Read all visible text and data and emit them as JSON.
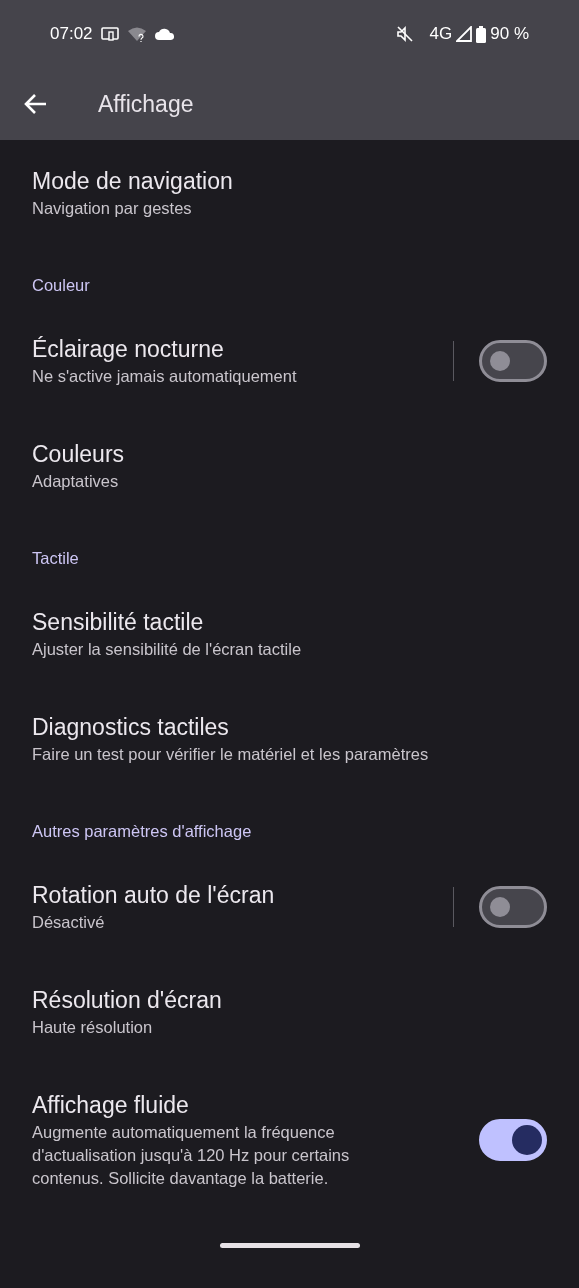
{
  "status_bar": {
    "time": "07:02",
    "network": "4G",
    "battery": "90 %"
  },
  "app_bar": {
    "title": "Affichage"
  },
  "items": [
    {
      "kind": "item",
      "title": "Mode de navigation",
      "subtitle": "Navigation par gestes"
    },
    {
      "kind": "header",
      "title": "Couleur"
    },
    {
      "kind": "toggle",
      "title": "Éclairage nocturne",
      "subtitle": "Ne s'active jamais automatiquement",
      "on": false
    },
    {
      "kind": "item",
      "title": "Couleurs",
      "subtitle": "Adaptatives"
    },
    {
      "kind": "header",
      "title": "Tactile"
    },
    {
      "kind": "item",
      "title": "Sensibilité tactile",
      "subtitle": "Ajuster la sensibilité de l'écran tactile"
    },
    {
      "kind": "item",
      "title": "Diagnostics tactiles",
      "subtitle": "Faire un test pour vérifier le matériel et les paramètres"
    },
    {
      "kind": "header",
      "title": "Autres paramètres d'affichage"
    },
    {
      "kind": "toggle",
      "title": "Rotation auto de l'écran",
      "subtitle": "Désactivé",
      "on": false
    },
    {
      "kind": "item",
      "title": "Résolution d'écran",
      "subtitle": "Haute résolution"
    },
    {
      "kind": "toggle",
      "title": "Affichage fluide",
      "subtitle": "Augmente automatiquement la fréquence d'actualisation jusqu'à 120 Hz pour certains contenus. Sollicite davantage la batterie.",
      "on": true
    }
  ]
}
